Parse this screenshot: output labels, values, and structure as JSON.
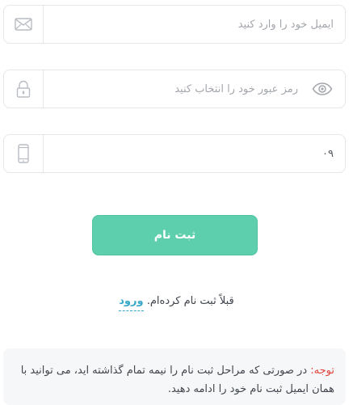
{
  "form": {
    "email": {
      "placeholder": "ایمیل خود را وارد کنید",
      "icon": "mail-icon"
    },
    "password": {
      "placeholder": "رمز عبور خود را انتخاب کنید",
      "icon": "lock-icon",
      "toggle_icon": "eye-icon"
    },
    "phone": {
      "value": "۰۹",
      "icon": "phone-icon"
    },
    "submit_label": "ثبت نام"
  },
  "login": {
    "text": "قبلاً ثبت نام کرده‌ام.",
    "link_label": "ورود"
  },
  "note": {
    "label": "توجه:",
    "text": "در صورتی که مراحل ثبت نام را نیمه تمام گذاشته اید، می توانید با همان ایمیل ثبت نام خود را ادامه دهید."
  },
  "colors": {
    "accent": "#5dcfad",
    "link": "#3aa8c8",
    "warning": "#e0433c"
  }
}
